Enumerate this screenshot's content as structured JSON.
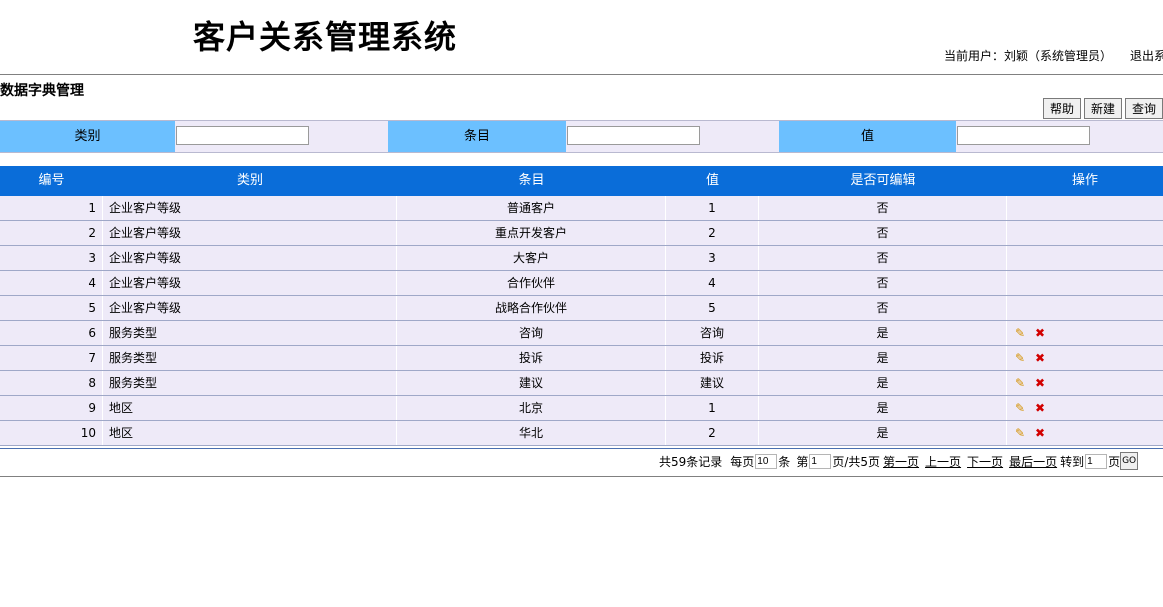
{
  "header": {
    "title": "客户关系管理系统",
    "user_label": "当前用户：刘颖（系统管理员）",
    "logout": "退出系"
  },
  "section_title": "数据字典管理",
  "toolbar": {
    "help": "帮助",
    "new": "新建",
    "query": "查询"
  },
  "search": {
    "type_label": "类别",
    "type_value": "",
    "item_label": "条目",
    "item_value": "",
    "value_label": "值",
    "value_value": ""
  },
  "table": {
    "headers": {
      "id": "编号",
      "type": "类别",
      "item": "条目",
      "value": "值",
      "editable": "是否可编辑",
      "ops": "操作"
    },
    "rows": [
      {
        "id": "1",
        "type": "企业客户等级",
        "item": "普通客户",
        "value": "1",
        "editable": "否"
      },
      {
        "id": "2",
        "type": "企业客户等级",
        "item": "重点开发客户",
        "value": "2",
        "editable": "否"
      },
      {
        "id": "3",
        "type": "企业客户等级",
        "item": "大客户",
        "value": "3",
        "editable": "否"
      },
      {
        "id": "4",
        "type": "企业客户等级",
        "item": "合作伙伴",
        "value": "4",
        "editable": "否"
      },
      {
        "id": "5",
        "type": "企业客户等级",
        "item": "战略合作伙伴",
        "value": "5",
        "editable": "否"
      },
      {
        "id": "6",
        "type": "服务类型",
        "item": "咨询",
        "value": "咨询",
        "editable": "是"
      },
      {
        "id": "7",
        "type": "服务类型",
        "item": "投诉",
        "value": "投诉",
        "editable": "是"
      },
      {
        "id": "8",
        "type": "服务类型",
        "item": "建议",
        "value": "建议",
        "editable": "是"
      },
      {
        "id": "9",
        "type": "地区",
        "item": "北京",
        "value": "1",
        "editable": "是"
      },
      {
        "id": "10",
        "type": "地区",
        "item": "华北",
        "value": "2",
        "editable": "是"
      }
    ]
  },
  "pager": {
    "total": "共59条记录",
    "per_page_label": "每页",
    "per_page_value": "10",
    "per_page_unit": "条",
    "page_label": "第",
    "page_value": "1",
    "page_total": "页/共5页",
    "first": "第一页",
    "prev": "上一页",
    "next": "下一页",
    "last": "最后一页",
    "goto_label": "转到",
    "goto_value": "1",
    "goto_unit": "页",
    "go": "GO"
  }
}
